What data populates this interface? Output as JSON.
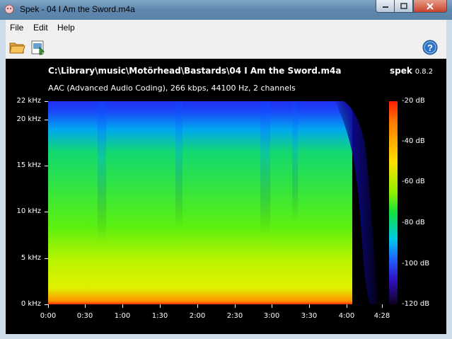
{
  "window": {
    "title": "Spek - 04 I Am the Sword.m4a"
  },
  "menu": {
    "file": "File",
    "edit": "Edit",
    "help": "Help"
  },
  "toolbar": {
    "open_icon": "folder-open-icon",
    "save_icon": "save-image-icon",
    "help_icon": "help-icon"
  },
  "header": {
    "filepath": "C:\\Library\\music\\Motörhead\\Bastards\\04 I Am the Sword.m4a",
    "brand": "spek",
    "version": "0.8.2",
    "fileinfo": "AAC (Advanced Audio Coding), 266 kbps, 44100 Hz, 2 channels"
  },
  "freq_labels": [
    "22 kHz",
    "20 kHz",
    "15 kHz",
    "10 kHz",
    "5 kHz",
    "0 kHz"
  ],
  "time_labels": [
    "0:00",
    "0:30",
    "1:00",
    "1:30",
    "2:00",
    "2:30",
    "3:00",
    "3:30",
    "4:00",
    "4:28"
  ],
  "db_labels": [
    "-20 dB",
    "-40 dB",
    "-60 dB",
    "-80 dB",
    "-100 dB",
    "-120 dB"
  ]
}
